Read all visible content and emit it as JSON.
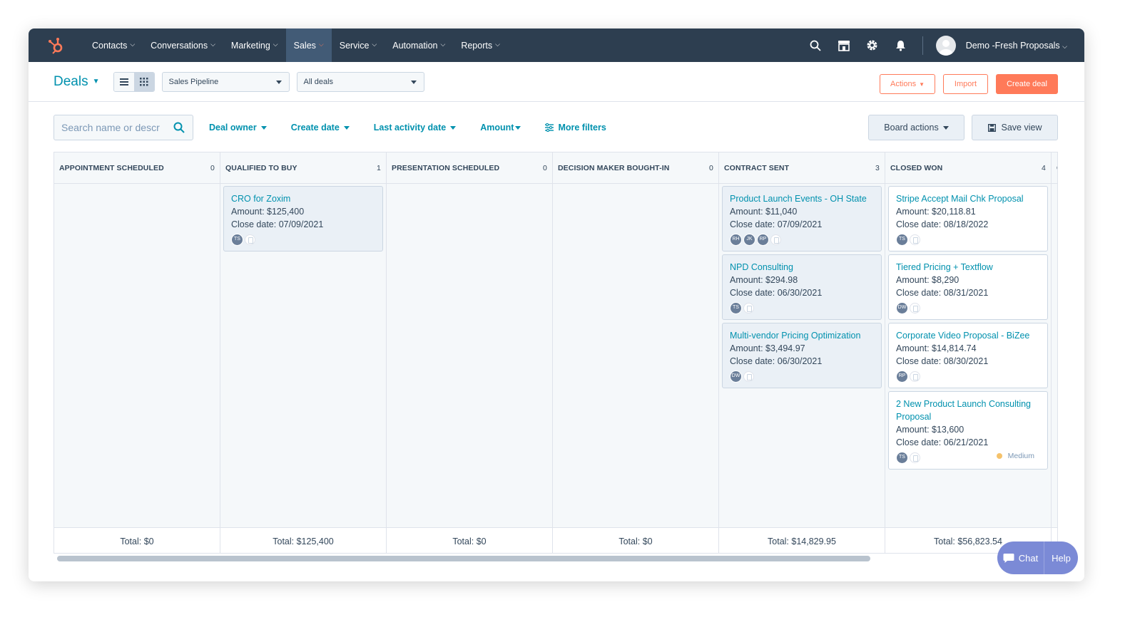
{
  "nav": {
    "items": [
      "Contacts",
      "Conversations",
      "Marketing",
      "Sales",
      "Service",
      "Automation",
      "Reports"
    ],
    "active": "Sales",
    "account_name": "Demo -Fresh Proposals"
  },
  "header": {
    "title": "Deals",
    "pipeline": "Sales Pipeline",
    "view": "All deals",
    "actions_label": "Actions",
    "import_label": "Import",
    "create_label": "Create deal"
  },
  "filters": {
    "search_placeholder": "Search name or descr",
    "deal_owner": "Deal owner",
    "create_date": "Create date",
    "last_activity": "Last activity date",
    "amount": "Amount",
    "more_filters": "More filters",
    "board_actions": "Board actions",
    "save_view": "Save view"
  },
  "columns": [
    {
      "title": "APPOINTMENT SCHEDULED",
      "count": "0",
      "total": "Total: $0",
      "cards": []
    },
    {
      "title": "QUALIFIED TO BUY",
      "count": "1",
      "total": "Total: $125,400",
      "cards": [
        {
          "name": "CRO for Zoxim",
          "amount": "Amount: $125,400",
          "close": "Close date: 07/09/2021",
          "owners": [
            "TS"
          ]
        }
      ]
    },
    {
      "title": "PRESENTATION SCHEDULED",
      "count": "0",
      "total": "Total: $0",
      "cards": []
    },
    {
      "title": "DECISION MAKER BOUGHT-IN",
      "count": "0",
      "total": "Total: $0",
      "cards": []
    },
    {
      "title": "CONTRACT SENT",
      "count": "3",
      "total": "Total: $14,829.95",
      "cards": [
        {
          "name": "Product Launch Events - OH State",
          "amount": "Amount: $11,040",
          "close": "Close date: 07/09/2021",
          "owners": [
            "RH",
            "JK",
            "RP"
          ]
        },
        {
          "name": "NPD Consulting",
          "amount": "Amount: $294.98",
          "close": "Close date: 06/30/2021",
          "owners": [
            "TS"
          ]
        },
        {
          "name": "Multi-vendor Pricing Optimization",
          "amount": "Amount: $3,494.97",
          "close": "Close date: 06/30/2021",
          "owners": [
            "DW"
          ]
        }
      ]
    },
    {
      "title": "CLOSED WON",
      "count": "4",
      "total": "Total: $56,823.54",
      "cards": [
        {
          "name": "Stripe Accept Mail Chk Proposal",
          "amount": "Amount: $20,118.81",
          "close": "Close date: 08/18/2022",
          "owners": [
            "TS"
          ]
        },
        {
          "name": "Tiered Pricing + Textflow",
          "amount": "Amount: $8,290",
          "close": "Close date: 08/31/2021",
          "owners": [
            "DW"
          ]
        },
        {
          "name": "Corporate Video Proposal - BiZee",
          "amount": "Amount: $14,814.74",
          "close": "Close date: 08/30/2021",
          "owners": [
            "RP"
          ]
        },
        {
          "name": "2 New Product Launch Consulting Proposal",
          "amount": "Amount: $13,600",
          "close": "Close date: 06/21/2021",
          "owners": [
            "TS"
          ],
          "priority": "Medium"
        }
      ]
    },
    {
      "title": "C",
      "count": "",
      "total": "",
      "cards": []
    }
  ],
  "chat": {
    "chat_label": "Chat",
    "help_label": "Help"
  },
  "colors": {
    "nav_bg": "#2d3e50",
    "accent": "#ff7a59",
    "link": "#0091ae",
    "priority_medium": "#f5c26b"
  }
}
